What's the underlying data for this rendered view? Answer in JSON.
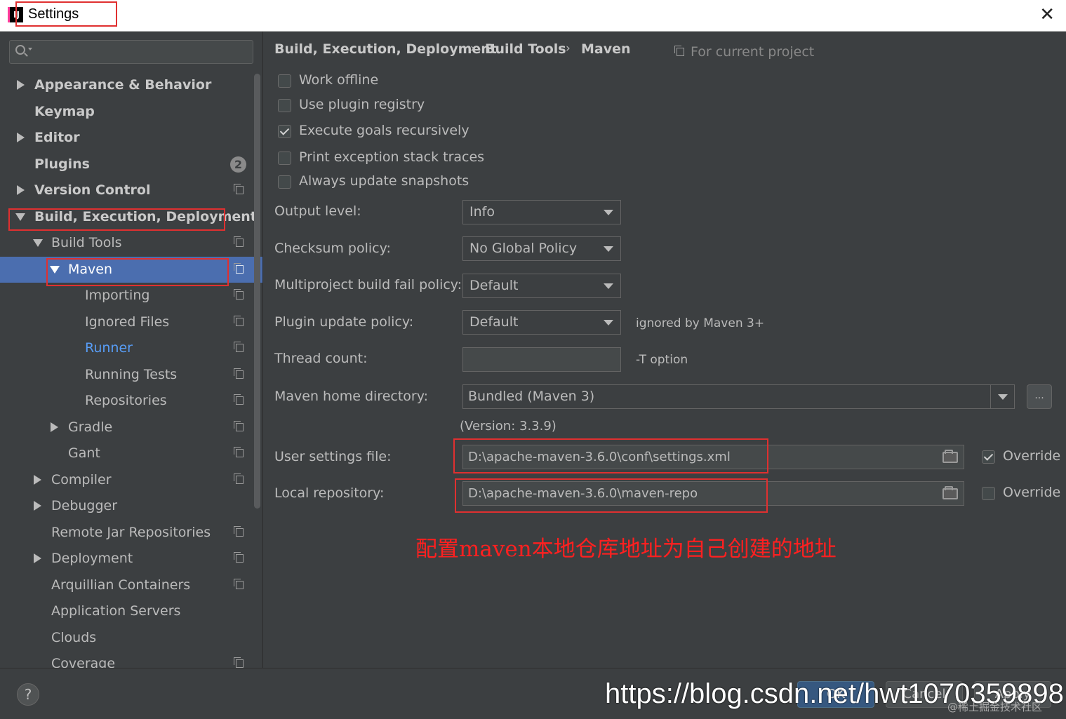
{
  "window": {
    "title": "Settings",
    "app_icon_text": "IJ"
  },
  "search": {
    "placeholder": ""
  },
  "sidebar": {
    "items": [
      {
        "label": "Appearance & Behavior"
      },
      {
        "label": "Keymap"
      },
      {
        "label": "Editor"
      },
      {
        "label": "Plugins",
        "badge": "2"
      },
      {
        "label": "Version Control"
      },
      {
        "label": "Build, Execution, Deployment"
      },
      {
        "label": "Build Tools"
      },
      {
        "label": "Maven"
      },
      {
        "label": "Importing"
      },
      {
        "label": "Ignored Files"
      },
      {
        "label": "Runner"
      },
      {
        "label": "Running Tests"
      },
      {
        "label": "Repositories"
      },
      {
        "label": "Gradle"
      },
      {
        "label": "Gant"
      },
      {
        "label": "Compiler"
      },
      {
        "label": "Debugger"
      },
      {
        "label": "Remote Jar Repositories"
      },
      {
        "label": "Deployment"
      },
      {
        "label": "Arquillian Containers"
      },
      {
        "label": "Application Servers"
      },
      {
        "label": "Clouds"
      },
      {
        "label": "Coverage"
      }
    ]
  },
  "breadcrumb": {
    "items": [
      "Build, Execution, Deployment",
      "Build Tools",
      "Maven"
    ],
    "separator": "›",
    "scope": "For current project"
  },
  "options": {
    "work_offline": "Work offline",
    "use_plugin_registry": "Use plugin registry",
    "execute_goals": "Execute goals recursively",
    "print_exception": "Print exception stack traces",
    "always_update": "Always update snapshots"
  },
  "form": {
    "output_level": {
      "label": "Output level:",
      "value": "Info"
    },
    "checksum_policy": {
      "label": "Checksum policy:",
      "value": "No Global Policy"
    },
    "multiproject_policy": {
      "label": "Multiproject build fail policy:",
      "value": "Default"
    },
    "plugin_update_policy": {
      "label": "Plugin update policy:",
      "value": "Default",
      "hint": "ignored by Maven 3+"
    },
    "thread_count": {
      "label": "Thread count:",
      "value": "",
      "hint": "-T option"
    },
    "maven_home": {
      "label": "Maven home directory:",
      "value": "Bundled (Maven 3)",
      "browse": "...",
      "version": "(Version: 3.3.9)"
    },
    "user_settings": {
      "label": "User settings file:",
      "value": "D:\\apache-maven-3.6.0\\conf\\settings.xml",
      "override": "Override"
    },
    "local_repo": {
      "label": "Local repository:",
      "value": "D:\\apache-maven-3.6.0\\maven-repo",
      "override": "Override"
    }
  },
  "annotation": "配置maven本地仓库地址为自己创建的地址",
  "footer": {
    "help": "?",
    "ok": "OK",
    "cancel": "Cancel",
    "apply": "Apply",
    "watermark": "https://blog.csdn.net/hwt1070359898",
    "watermark2": "@稀土掘金技术社区"
  },
  "colors": {
    "accent": "#4b6eaf",
    "annotation": "#ff2020",
    "link": "#589df6"
  }
}
